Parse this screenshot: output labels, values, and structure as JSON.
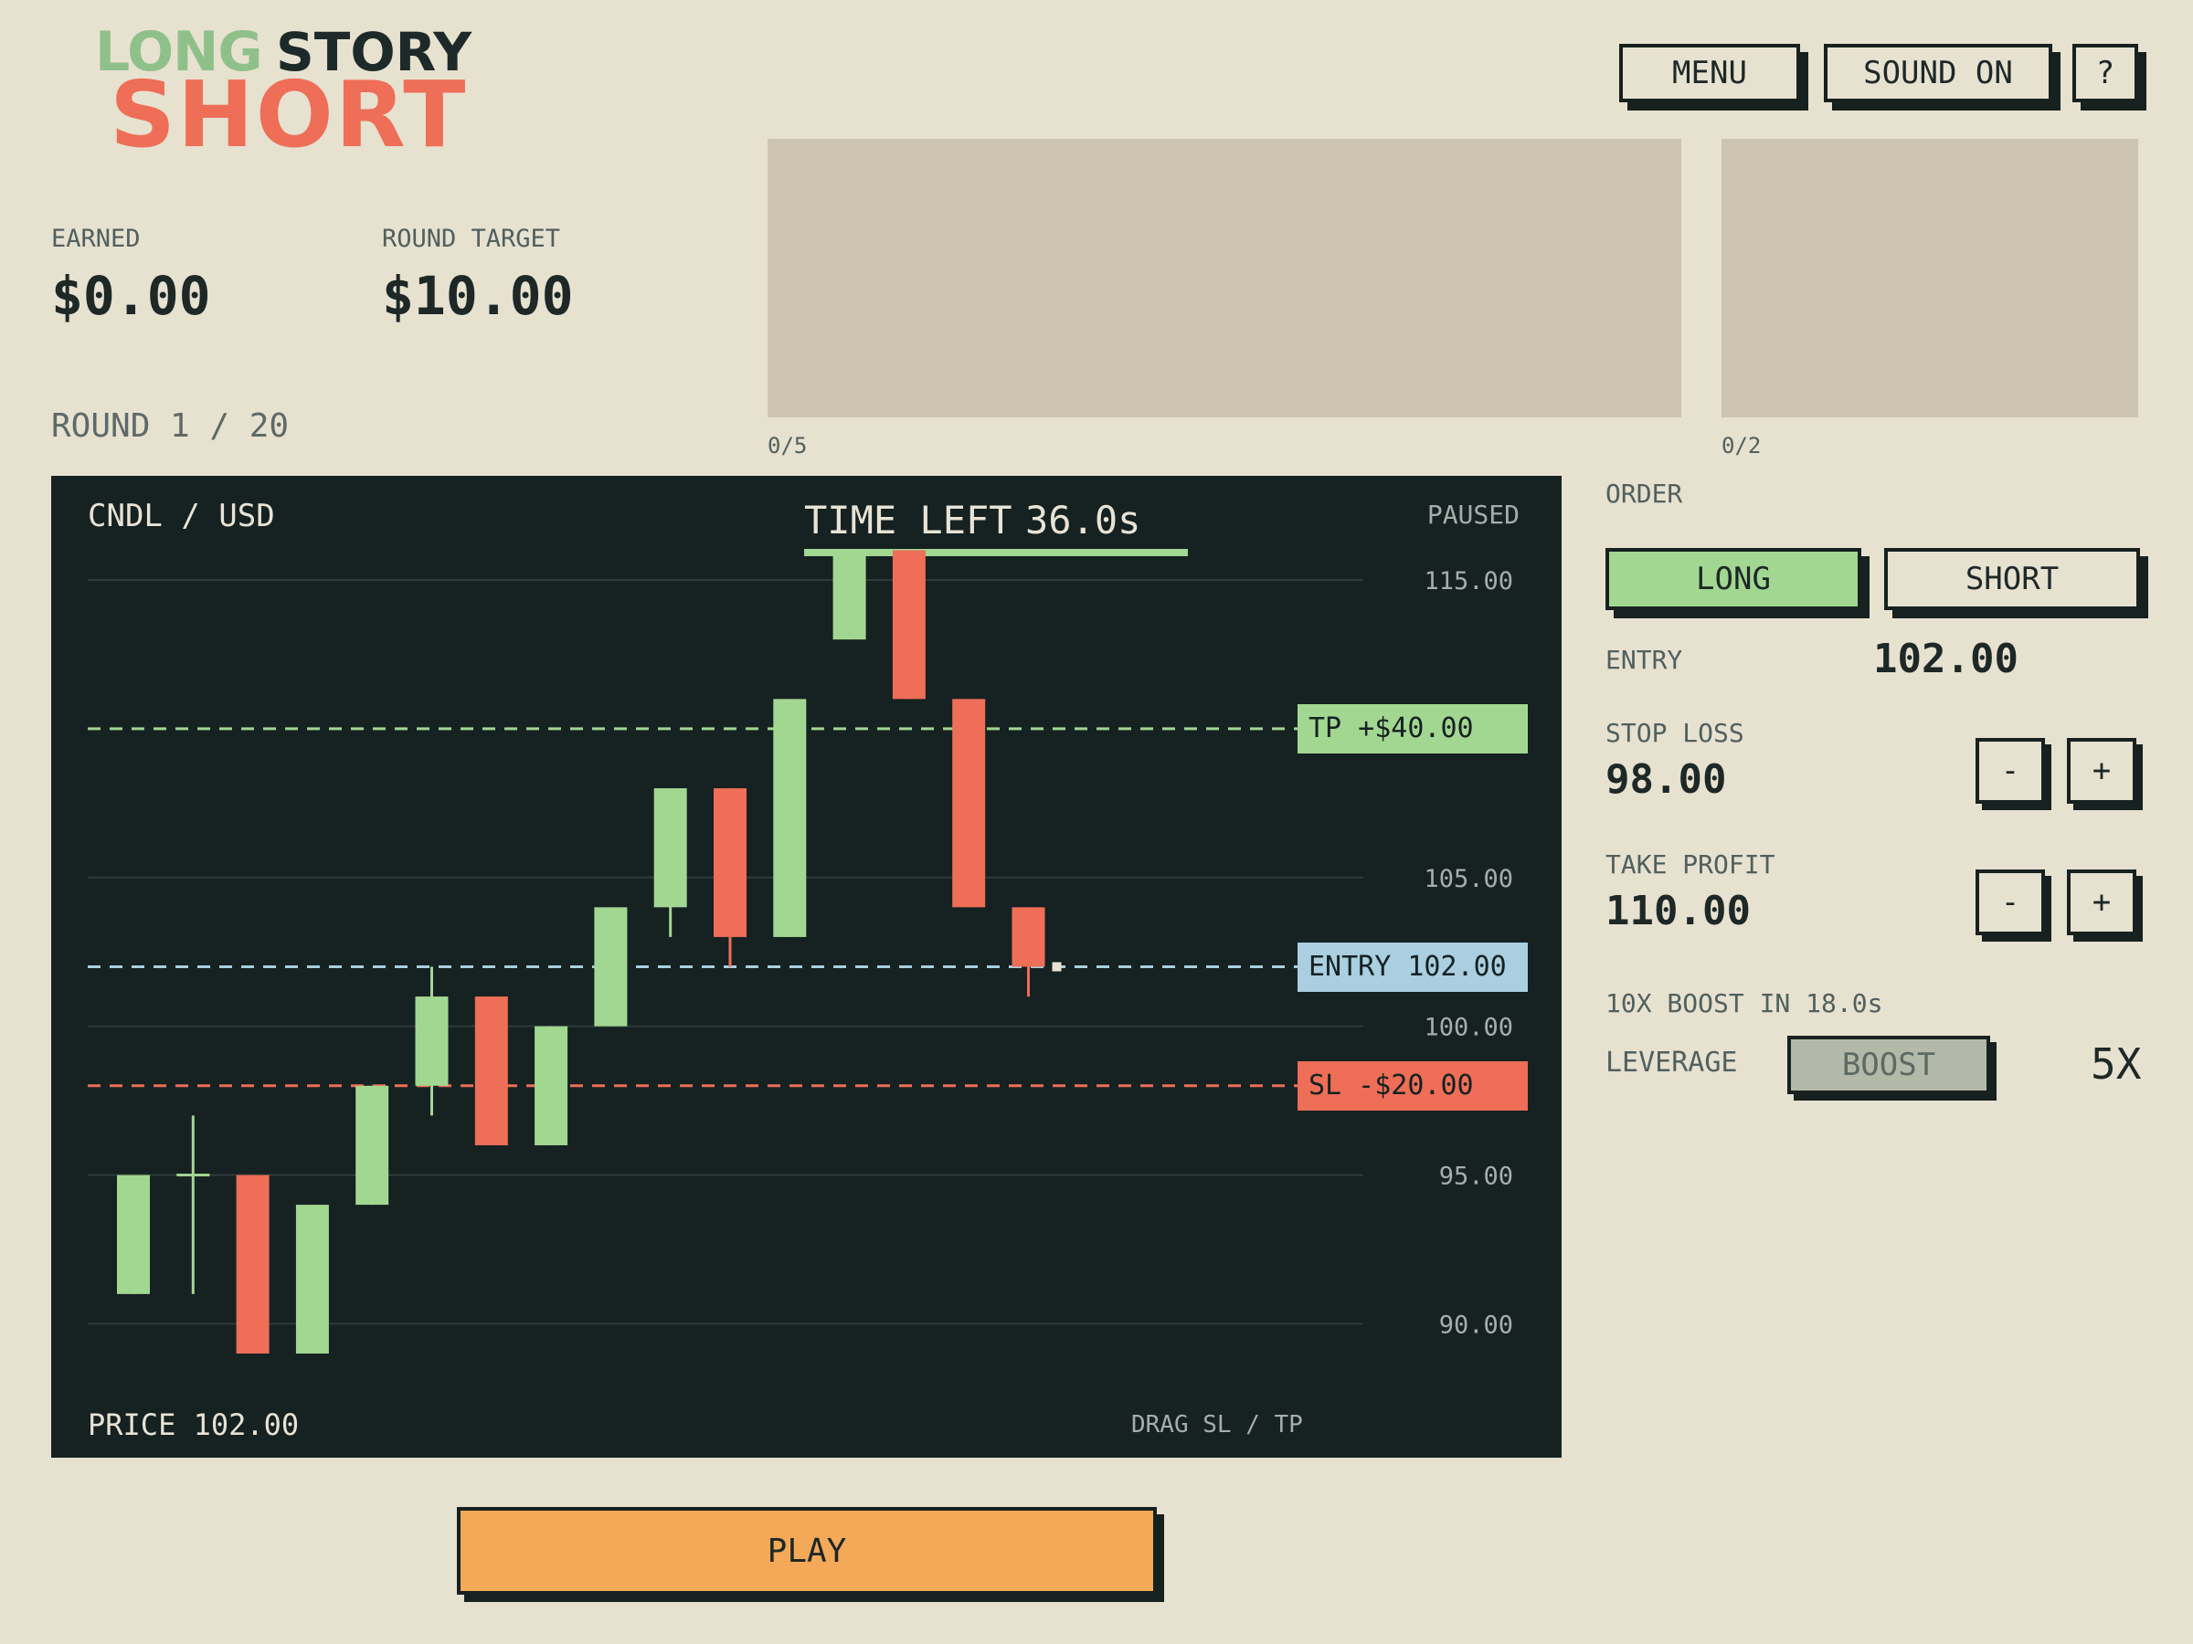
{
  "logo": {
    "line1a": "LONG",
    "line1b": "STORY",
    "line2": "SHORT"
  },
  "header": {
    "menu_label": "MENU",
    "sound_label": "SOUND ON",
    "help_label": "?"
  },
  "stats": {
    "earned_label": "EARNED",
    "earned_value": "$0.00",
    "target_label": "ROUND TARGET",
    "target_value": "$10.00",
    "round_text": "ROUND 1 / 20"
  },
  "panels": {
    "left_progress": "0/5",
    "right_progress": "0/2"
  },
  "chart": {
    "pair": "CNDL / USD",
    "time_left_label": "TIME LEFT",
    "time_left_value": "36.0s",
    "time_left_fraction": 1.0,
    "status": "PAUSED",
    "price_text": "PRICE 102.00",
    "hint": "DRAG SL / TP",
    "tp_tag": "TP +$40.00",
    "entry_tag": "ENTRY 102.00",
    "sl_tag": "SL -$20.00",
    "colors": {
      "up": "#a2d792",
      "down": "#ee6e57",
      "bg": "#162122",
      "entry": "#a9cfe0",
      "grid": "#2f3b3a"
    }
  },
  "chart_data": {
    "type": "candlestick",
    "y_ticks": [
      "115.00",
      "105.00",
      "100.00",
      "95.00",
      "90.00"
    ],
    "ylim": [
      85.5,
      118.5
    ],
    "levels": {
      "take_profit": 110.0,
      "entry": 102.0,
      "stop_loss": 98.0
    },
    "candles": [
      {
        "open": 91.0,
        "close": 95.0,
        "high": 95.0,
        "low": 91.0
      },
      {
        "open": 95.0,
        "close": 95.0,
        "high": 97.0,
        "low": 91.0
      },
      {
        "open": 95.0,
        "close": 89.0,
        "high": 95.0,
        "low": 89.0
      },
      {
        "open": 89.0,
        "close": 94.0,
        "high": 94.0,
        "low": 89.0
      },
      {
        "open": 94.0,
        "close": 98.0,
        "high": 98.0,
        "low": 94.0
      },
      {
        "open": 98.0,
        "close": 101.0,
        "high": 102.0,
        "low": 97.0
      },
      {
        "open": 101.0,
        "close": 96.0,
        "high": 101.0,
        "low": 96.0
      },
      {
        "open": 96.0,
        "close": 100.0,
        "high": 100.0,
        "low": 96.0
      },
      {
        "open": 100.0,
        "close": 104.0,
        "high": 104.0,
        "low": 100.0
      },
      {
        "open": 104.0,
        "close": 108.0,
        "high": 108.0,
        "low": 103.0
      },
      {
        "open": 108.0,
        "close": 103.0,
        "high": 108.0,
        "low": 102.0
      },
      {
        "open": 103.0,
        "close": 111.0,
        "high": 111.0,
        "low": 103.0
      },
      {
        "open": 113.0,
        "close": 116.0,
        "high": 116.0,
        "low": 113.0
      },
      {
        "open": 116.0,
        "close": 111.0,
        "high": 116.0,
        "low": 111.0
      },
      {
        "open": 111.0,
        "close": 104.0,
        "high": 111.0,
        "low": 104.0
      },
      {
        "open": 104.0,
        "close": 102.0,
        "high": 104.0,
        "low": 101.0
      }
    ],
    "current_price": 102.0
  },
  "order": {
    "title": "ORDER",
    "long_label": "LONG",
    "short_label": "SHORT",
    "selected": "LONG",
    "entry_label": "ENTRY",
    "entry_value": "102.00",
    "sl_label": "STOP LOSS",
    "sl_value": "98.00",
    "tp_label": "TAKE PROFIT",
    "tp_value": "110.00",
    "minus": "-",
    "plus": "+",
    "boost_timer": "10X BOOST IN 18.0s",
    "leverage_label": "LEVERAGE",
    "boost_label": "BOOST",
    "leverage_value": "5X"
  },
  "play_label": "PLAY"
}
